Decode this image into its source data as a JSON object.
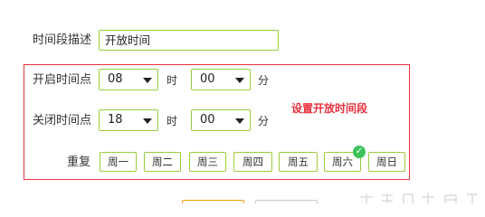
{
  "form": {
    "desc_label": "时间段描述",
    "desc_value": "开放时间",
    "open_label": "开启时间点",
    "open_hour": "08",
    "open_minute": "00",
    "close_label": "关闭时间点",
    "close_hour": "18",
    "close_minute": "00",
    "hour_unit": "时",
    "minute_unit": "分",
    "repeat_label": "重复",
    "days": [
      "周一",
      "周二",
      "周三",
      "周四",
      "周五",
      "周六",
      "周日"
    ],
    "days_selected": [
      "周六"
    ]
  },
  "annotation": "设置开放时间段",
  "colors": {
    "input_border": "#9ccc3c",
    "annotation_red": "#e8313c",
    "check_green": "#3cc35a",
    "save_border": "#f39c12"
  }
}
